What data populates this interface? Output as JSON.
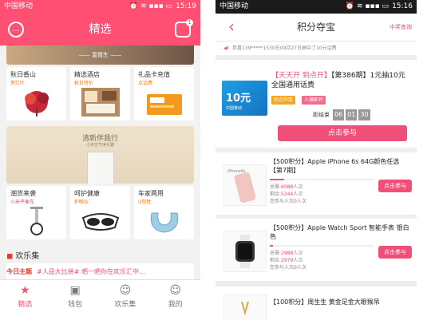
{
  "left": {
    "status": {
      "carrier": "中国移动",
      "time": "15:19",
      "icons": "⏰ ≋ ▪▪▪ ▭"
    },
    "header": {
      "title": "精选",
      "left_icon": "chat-bubble-icon",
      "right_icon": "message-icon",
      "badge": "1"
    },
    "banner": {
      "text": "—— 富情生 ——"
    },
    "row1": [
      {
        "title": "秋日香山",
        "subtitle": "赏红叶",
        "subtitle_color": "#ff7a00"
      },
      {
        "title": "精选酒店",
        "subtitle": "秋日特价",
        "subtitle_color": "#ff7a00"
      },
      {
        "title": "礼品卡充值",
        "subtitle": "点话费",
        "subtitle_color": "#ff7a00"
      }
    ],
    "promo": {
      "title": "清新伴我行",
      "subtitle": "小米空气净化器"
    },
    "row2": [
      {
        "title": "潮货来袭",
        "subtitle": "小米平衡车",
        "subtitle_color": "#ee4f72"
      },
      {
        "title": "呵护健康",
        "subtitle": "护眼仪",
        "subtitle_color": "#ff7a00"
      },
      {
        "title": "车家两用",
        "subtitle": "U型枕",
        "subtitle_color": "#ff7a00"
      }
    ],
    "happy": {
      "title": "欢乐集",
      "logo": "今日主题",
      "text": "#人品大比拼# 晒一晒你在欢乐汇中..."
    },
    "tabs": [
      {
        "label": "精选",
        "icon": "★"
      },
      {
        "label": "钱包",
        "icon": "▣"
      },
      {
        "label": "欢乐集",
        "icon": "☺"
      },
      {
        "label": "我的",
        "icon": "☺"
      }
    ]
  },
  "right": {
    "status": {
      "carrier": "中国移动",
      "time": "15:16",
      "icons": "⏰ ≋ ▪▪▪ ▭"
    },
    "header": {
      "title": "积分夺宝",
      "link": "中奖查询",
      "back": "‹"
    },
    "notice": "恭喜139*****1530在09月27日抽中了10元话费",
    "main": {
      "img_value": "10元",
      "img_brand": "中国移动",
      "title_red": "【天天开 到点开】",
      "title_rest": "【第386期】1元抽10元全国通用话费",
      "tag1": "到点开奖",
      "tag2": "人满即开",
      "countdown_label": "距结束",
      "countdown": [
        "06",
        "01",
        "30"
      ],
      "join": "点击参与"
    },
    "items": [
      {
        "name": "【500积分】Apple iPhone 6s 64G颜色任选【第7期】",
        "total_label": "总需:",
        "total": "6088",
        "unit": "人次",
        "remain_label": "剩余:",
        "remain": "5244",
        "thumb_text": "iPhone6s",
        "progress": 0.14,
        "my_label": "您参与人次",
        "my": "0",
        "join": "点击参与"
      },
      {
        "name": "【500积分】Apple Watch Sport 智能手表 银白色",
        "total_label": "总需:",
        "total": "2988",
        "unit": "人次",
        "remain_label": "剩余:",
        "remain": "2979",
        "thumb_text": "",
        "progress": 0.03,
        "my_label": "您参与人次",
        "my": "0",
        "join": "点击参与"
      },
      {
        "name": "【100积分】周生生 黄金足金大眼猴吊",
        "thumb_text": "",
        "join": ""
      }
    ]
  },
  "colors": {
    "accent": "#ff4f72",
    "button": "#f05078"
  }
}
